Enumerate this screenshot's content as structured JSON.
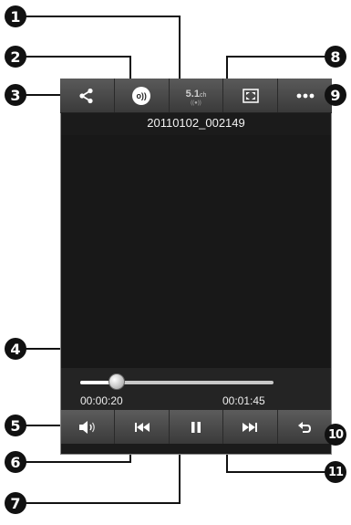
{
  "player": {
    "file_name": "20110102_002149",
    "elapsed_time": "00:00:20",
    "total_time": "00:01:45",
    "progress_fraction": 0.19
  },
  "top_bar": {
    "buttons": [
      "share-icon",
      "sound-effect-icon",
      "surround-5-1-icon",
      "screen-mode-icon",
      "more-options-icon"
    ],
    "surround_label": "5.1",
    "surround_suffix": "ch",
    "sound_effect_label": "o))"
  },
  "control_bar": {
    "buttons": [
      "volume-icon",
      "rewind-icon",
      "pause-icon",
      "fast-forward-icon",
      "back-icon"
    ]
  },
  "callouts": [
    "1",
    "2",
    "3",
    "4",
    "5",
    "6",
    "7",
    "8",
    "9",
    "10",
    "11"
  ],
  "colors": {
    "screen_bg": "#1b1b1b",
    "bar_top": "#5a5a5a",
    "bar_bottom": "#3a3a3a",
    "callout": "#111111"
  }
}
